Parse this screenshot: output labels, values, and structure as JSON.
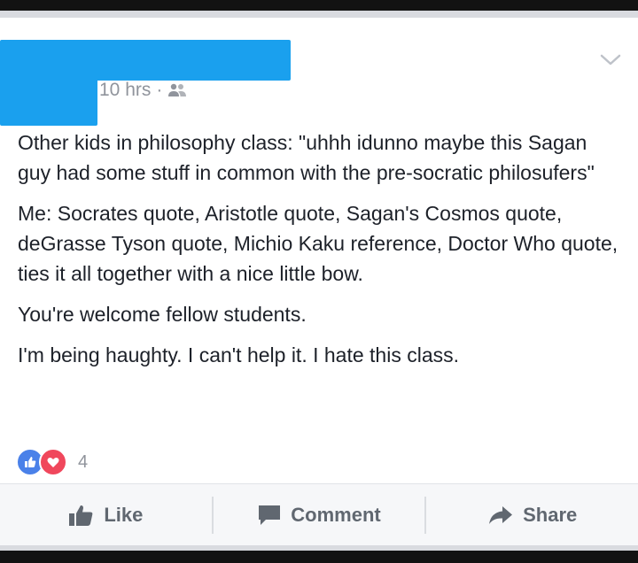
{
  "post": {
    "timestamp": "10 hrs",
    "separator": "·",
    "audience_icon": "friends-icon",
    "paragraphs": [
      "Other kids in philosophy class: \"uhhh idunno maybe this Sagan guy had some stuff in common with the pre-socratic philosufers\"",
      "Me: Socrates quote, Aristotle quote, Sagan's Cosmos quote, deGrasse Tyson quote, Michio Kaku reference, Doctor Who quote, ties it all together with a nice little bow.",
      "You're welcome fellow students.",
      "I'm being haughty. I can't help it. I hate this class."
    ],
    "reaction_count": "4"
  },
  "actions": {
    "like_label": "Like",
    "comment_label": "Comment",
    "share_label": "Share"
  },
  "colors": {
    "redaction": "#1aa0ee",
    "like_reaction": "#4a81e9",
    "love_reaction": "#f0475c",
    "text": "#1d2129",
    "meta": "#90949c",
    "action_text": "#606770"
  }
}
